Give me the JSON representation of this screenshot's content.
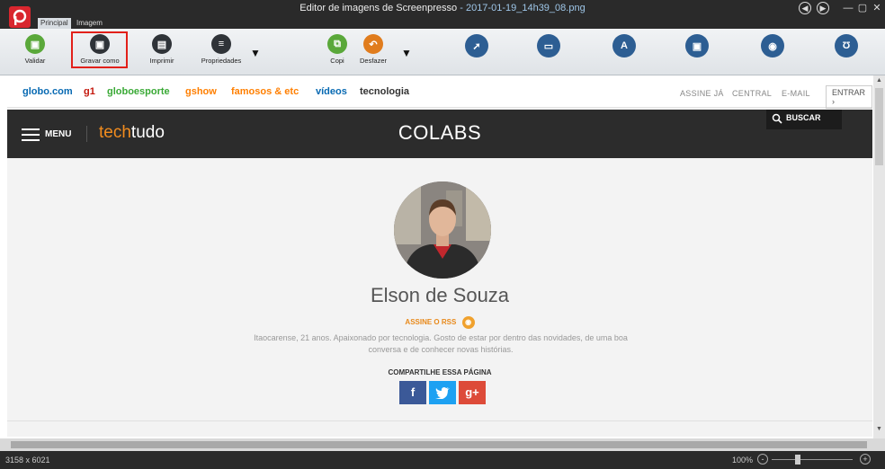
{
  "window": {
    "title_prefix": "Editor de imagens de Screenpresso",
    "title_file": "- 2017-01-19_14h39_08.png"
  },
  "tabs": [
    {
      "label": "Principal",
      "active": true
    },
    {
      "label": "Imagem",
      "active": false
    }
  ],
  "ribbon": {
    "validate": "Validar",
    "save_as": "Gravar como",
    "print": "Imprimir",
    "properties": "Propriedades",
    "copy": "Copi",
    "undo": "Desfazer",
    "tool_icons": [
      "arrow-tool-icon",
      "rectangle-tool-icon",
      "text-tool-icon",
      "callout-tool-icon",
      "highlight-tool-icon",
      "magnet-tool-icon"
    ]
  },
  "globo_bar": {
    "links": [
      {
        "label": "globo.com",
        "color": "#0669b2"
      },
      {
        "label": "g1",
        "color": "#c4170c"
      },
      {
        "label": "globoesporte",
        "color": "#39a935"
      },
      {
        "label": "gshow",
        "color": "#ff7f00"
      },
      {
        "label": "famosos & etc",
        "color": "#ff7f00"
      },
      {
        "label": "vídeos",
        "color": "#0669b2"
      },
      {
        "label": "tecnologia",
        "color": "#333333"
      }
    ],
    "right": [
      "ASSINE JÁ",
      "CENTRAL",
      "E-MAIL"
    ],
    "enter": "ENTRAR ›"
  },
  "site_header": {
    "menu": "MENU",
    "logo_tech": "tech",
    "logo_tudo": "tudo",
    "section": "COLABS",
    "search": "BUSCAR"
  },
  "profile": {
    "name": "Elson de Souza",
    "rss": "ASSINE O RSS",
    "bio": "Itaocarense, 21 anos. Apaixonado por tecnologia. Gosto de estar por dentro das novidades, de uma boa conversa e de conhecer novas histórias.",
    "share_label": "COMPARTILHE ESSA PÁGINA",
    "share_buttons": [
      {
        "label": "f",
        "color": "#3b5998"
      },
      {
        "label": "t",
        "color": "#1da1f2"
      },
      {
        "label": "g+",
        "color": "#dd4b39"
      }
    ]
  },
  "status": {
    "dimensions": "3158 x 6021",
    "zoom": "100%"
  }
}
